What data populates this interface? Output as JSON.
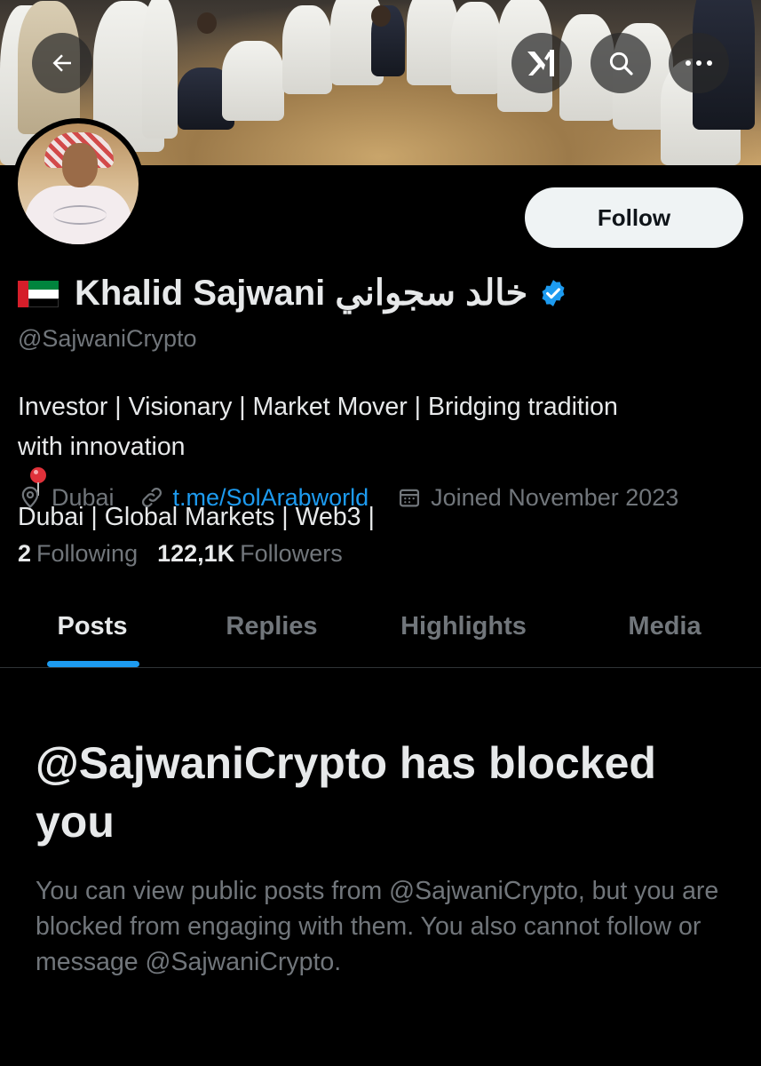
{
  "header": {
    "back_icon": "arrow-left-icon",
    "grok_icon": "grok-icon",
    "search_icon": "search-icon",
    "more_icon": "more-horizontal-icon"
  },
  "profile": {
    "flag_emoji": "uae-flag",
    "name": "Khalid Sajwani خالد سجواني",
    "verified": true,
    "handle": "@SajwaniCrypto",
    "follow_label": "Follow",
    "bio_line1": "Investor | Visionary | Market Mover | Bridging tradition",
    "bio_line2_a": "with innovation",
    "bio_line2_b": "Dubai | Global Markets | Web3 |",
    "location": "Dubai",
    "website": "t.me/SolArabworld",
    "joined": "Joined November 2023",
    "following_count": "2",
    "following_label": "Following",
    "followers_count": "122,1K",
    "followers_label": "Followers"
  },
  "tabs": [
    {
      "label": "Posts",
      "active": true
    },
    {
      "label": "Replies",
      "active": false
    },
    {
      "label": "Highlights",
      "active": false
    },
    {
      "label": "Media",
      "active": false
    }
  ],
  "blocked": {
    "title": "@SajwaniCrypto has blocked you",
    "description": "You can view public posts from @SajwaniCrypto, but you are blocked from engaging with them. You also cannot follow or message @SajwaniCrypto."
  },
  "colors": {
    "background": "#000000",
    "text": "#e7e9ea",
    "secondary": "#71767b",
    "accent": "#1d9bf0"
  }
}
